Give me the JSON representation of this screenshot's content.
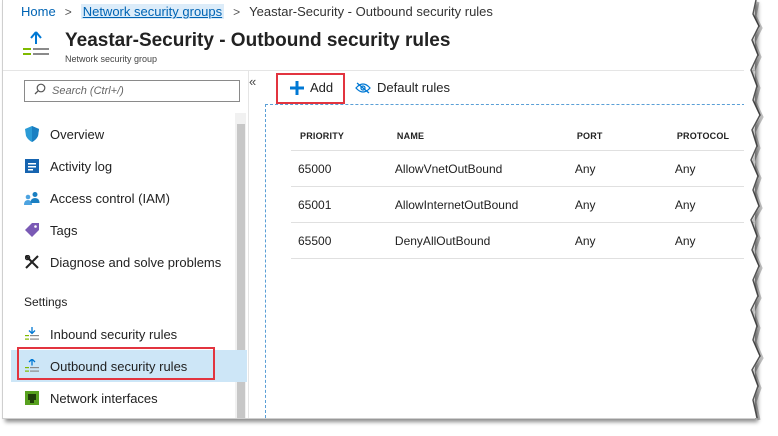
{
  "breadcrumb": {
    "home": "Home",
    "nsg": "Network security groups",
    "current": "Yeastar-Security - Outbound security rules"
  },
  "header": {
    "title": "Yeastar-Security - Outbound security rules",
    "subtitle": "Network security group"
  },
  "sidebar": {
    "search_placeholder": "Search (Ctrl+/)",
    "collapse": "«",
    "items": [
      {
        "label": "Overview",
        "icon": "shield-icon"
      },
      {
        "label": "Activity log",
        "icon": "activity-log-icon"
      },
      {
        "label": "Access control (IAM)",
        "icon": "people-icon"
      },
      {
        "label": "Tags",
        "icon": "tag-icon"
      },
      {
        "label": "Diagnose and solve problems",
        "icon": "wrench-icon"
      }
    ],
    "section": "Settings",
    "settings_items": [
      {
        "label": "Inbound security rules",
        "icon": "inbound-rules-icon"
      },
      {
        "label": "Outbound security rules",
        "icon": "outbound-rules-icon",
        "active": true
      },
      {
        "label": "Network interfaces",
        "icon": "network-interface-icon"
      }
    ]
  },
  "toolbar": {
    "add_label": "Add",
    "default_rules_label": "Default rules"
  },
  "table": {
    "headers": [
      "PRIORITY",
      "NAME",
      "PORT",
      "PROTOCOL"
    ],
    "rows": [
      [
        "65000",
        "AllowVnetOutBound",
        "Any",
        "Any"
      ],
      [
        "65001",
        "AllowInternetOutBound",
        "Any",
        "Any"
      ],
      [
        "65500",
        "DenyAllOutBound",
        "Any",
        "Any"
      ]
    ]
  },
  "colors": {
    "accent": "#0078d4",
    "link": "#0064b4",
    "highlight_box": "#e2343f",
    "active_bg": "#cde6f7"
  }
}
